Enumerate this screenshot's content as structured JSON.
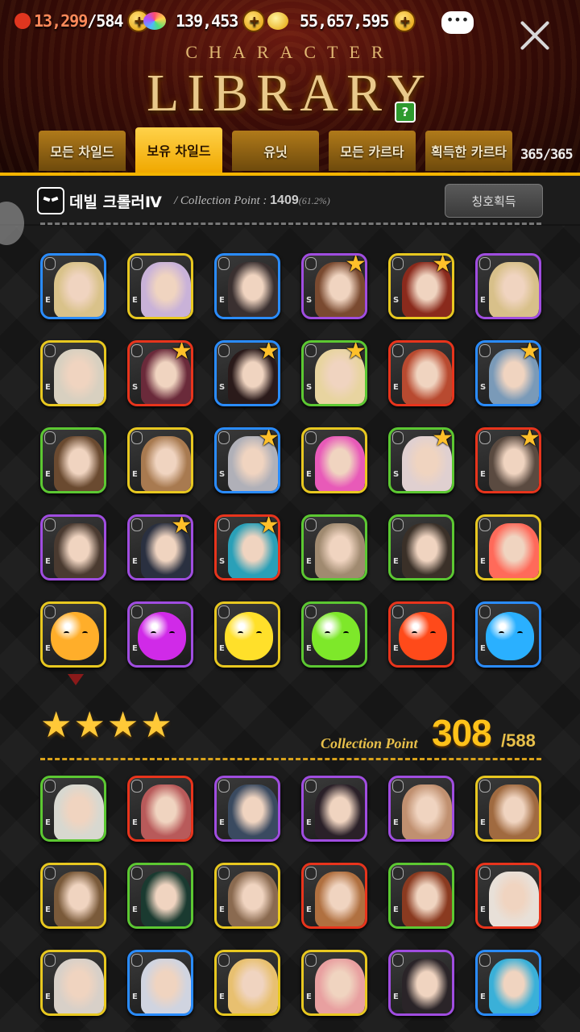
{
  "resources": {
    "stamina": {
      "value": "13,299",
      "max": "/584",
      "icon": "heart-icon"
    },
    "gems": {
      "value": "139,453",
      "icon": "rainbow-gem-icon"
    },
    "gold": {
      "value": "55,657,595",
      "icon": "gold-coin-icon"
    },
    "chat_icon": "chat-bubble-icon"
  },
  "title": {
    "small": "CHARACTER",
    "big": "LIBRARY",
    "help": "?"
  },
  "tabs": [
    {
      "label": "모든 차일드",
      "active": false
    },
    {
      "label": "보유 차일드",
      "active": true
    },
    {
      "label": "유닛",
      "active": false
    },
    {
      "label": "모든 카르타",
      "active": false
    },
    {
      "label": "획득한 카르타",
      "active": false
    }
  ],
  "tab_count": "365/365",
  "info": {
    "title_name": "데빌 크롤러Ⅳ",
    "cp_prefix": "/ Collection Point : ",
    "cp_value": "1409",
    "cp_percent": "(61.2%)",
    "title_button": "칭호획득"
  },
  "section_top": {
    "rows": [
      [
        {
          "border": "blue",
          "grade": "E",
          "star": false,
          "color": "#d9c28a"
        },
        {
          "border": "yellow",
          "grade": "E",
          "star": false,
          "color": "#c9b2d8"
        },
        {
          "border": "blue",
          "grade": "E",
          "star": false,
          "color": "#3a3030"
        },
        {
          "border": "purple",
          "grade": "S",
          "star": true,
          "color": "#7a4a30"
        },
        {
          "border": "yellow",
          "grade": "S",
          "star": true,
          "color": "#8a2a1c"
        },
        {
          "border": "purple",
          "grade": "E",
          "star": false,
          "color": "#d8c08a"
        }
      ],
      [
        {
          "border": "yellow",
          "grade": "E",
          "star": false,
          "color": "#d8d0c0"
        },
        {
          "border": "red",
          "grade": "S",
          "star": true,
          "color": "#6a2a3a"
        },
        {
          "border": "blue",
          "grade": "S",
          "star": true,
          "color": "#2a1a1a"
        },
        {
          "border": "green",
          "grade": "S",
          "star": true,
          "color": "#e8d4a0"
        },
        {
          "border": "red",
          "grade": "E",
          "star": false,
          "color": "#b84a30"
        },
        {
          "border": "blue",
          "grade": "S",
          "star": true,
          "color": "#7a9ab8"
        }
      ],
      [
        {
          "border": "green",
          "grade": "E",
          "star": false,
          "color": "#6a4a30"
        },
        {
          "border": "yellow",
          "grade": "E",
          "star": false,
          "color": "#a87a50"
        },
        {
          "border": "blue",
          "grade": "S",
          "star": true,
          "color": "#b0b0b8"
        },
        {
          "border": "yellow",
          "grade": "E",
          "star": false,
          "color": "#e85ab8"
        },
        {
          "border": "green",
          "grade": "S",
          "star": true,
          "color": "#e0d0d0"
        },
        {
          "border": "red",
          "grade": "E",
          "star": true,
          "color": "#5a4a40"
        }
      ],
      [
        {
          "border": "purple",
          "grade": "E",
          "star": false,
          "color": "#4a3a30"
        },
        {
          "border": "purple",
          "grade": "E",
          "star": true,
          "color": "#2a3040"
        },
        {
          "border": "red",
          "grade": "S",
          "star": true,
          "color": "#2aa0b8"
        },
        {
          "border": "green",
          "grade": "E",
          "star": false,
          "color": "#a08a70"
        },
        {
          "border": "green",
          "grade": "E",
          "star": false,
          "color": "#3a3028"
        },
        {
          "border": "yellow",
          "grade": "E",
          "star": false,
          "color": "#ff6a5a"
        }
      ],
      [
        {
          "border": "yellow",
          "grade": "E",
          "star": false,
          "slime": true,
          "color": "#ffae2a"
        },
        {
          "border": "purple",
          "grade": "E",
          "star": false,
          "slime": true,
          "color": "#d02ae8"
        },
        {
          "border": "yellow",
          "grade": "E",
          "star": false,
          "slime": true,
          "color": "#ffe02a"
        },
        {
          "border": "green",
          "grade": "E",
          "star": false,
          "slime": true,
          "color": "#7ee82a"
        },
        {
          "border": "red",
          "grade": "E",
          "star": false,
          "slime": true,
          "color": "#ff4a1a"
        },
        {
          "border": "blue",
          "grade": "E",
          "star": false,
          "slime": true,
          "color": "#2ab0ff"
        }
      ]
    ]
  },
  "section_4star": {
    "stars": 4,
    "cp_label": "Collection Point",
    "cp_value": "308",
    "cp_total": "/588",
    "rows": [
      [
        {
          "border": "green",
          "grade": "E",
          "color": "#d8d8d0"
        },
        {
          "border": "red",
          "grade": "E",
          "color": "#b85a5a"
        },
        {
          "border": "purple",
          "grade": "E",
          "color": "#3a4a60"
        },
        {
          "border": "purple",
          "grade": "E",
          "color": "#2a2028"
        },
        {
          "border": "purple",
          "grade": "E",
          "color": "#c09070"
        },
        {
          "border": "yellow",
          "grade": "E",
          "color": "#a06a40"
        }
      ],
      [
        {
          "border": "yellow",
          "grade": "E",
          "color": "#7a5a3a"
        },
        {
          "border": "green",
          "grade": "E",
          "color": "#1a3a30"
        },
        {
          "border": "yellow",
          "grade": "E",
          "color": "#8a6a50"
        },
        {
          "border": "red",
          "grade": "E",
          "color": "#b07040"
        },
        {
          "border": "green",
          "grade": "E",
          "color": "#8a3a20"
        },
        {
          "border": "red",
          "grade": "E",
          "color": "#e8e0d8"
        }
      ],
      [
        {
          "border": "yellow",
          "grade": "E",
          "color": "#d8d0c8"
        },
        {
          "border": "blue",
          "grade": "E",
          "color": "#d0d4e0"
        },
        {
          "border": "yellow",
          "grade": "E",
          "color": "#e8c070"
        },
        {
          "border": "yellow",
          "grade": "E",
          "color": "#e8a0a0"
        },
        {
          "border": "purple",
          "grade": "E",
          "color": "#2a2428"
        },
        {
          "border": "blue",
          "grade": "E",
          "color": "#3ab0d8"
        }
      ]
    ]
  }
}
